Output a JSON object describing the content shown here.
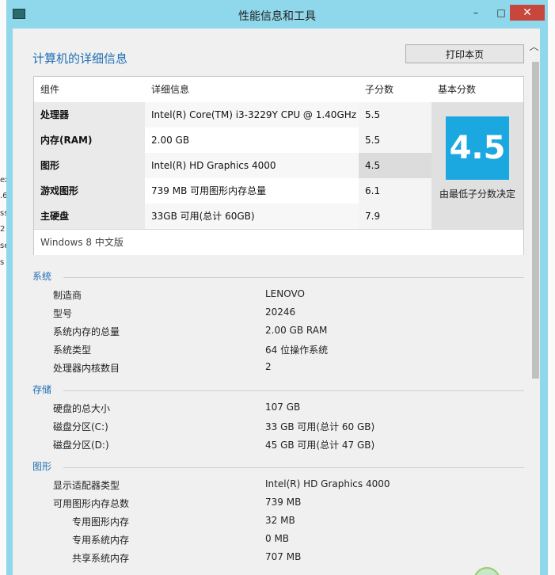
{
  "window": {
    "title": "性能信息和工具",
    "controls": {
      "minimize": "–",
      "maximize": "□",
      "close": "✕"
    }
  },
  "main": {
    "heading": "计算机的详细信息",
    "print_button": "打印本页",
    "score_table": {
      "headers": [
        "组件",
        "详细信息",
        "子分数",
        "基本分数"
      ],
      "rows": [
        {
          "component": "处理器",
          "detail": "Intel(R) Core(TM) i3-3229Y CPU @ 1.40GHz",
          "subscore": "5.5"
        },
        {
          "component": "内存(RAM)",
          "detail": "2.00 GB",
          "subscore": "5.5"
        },
        {
          "component": "图形",
          "detail": "Intel(R) HD Graphics 4000",
          "subscore": "4.5"
        },
        {
          "component": "游戏图形",
          "detail": "739 MB 可用图形内存总量",
          "subscore": "6.1"
        },
        {
          "component": "主硬盘",
          "detail": "33GB 可用(总计 60GB)",
          "subscore": "7.9"
        }
      ],
      "base_score": "4.5",
      "base_note": "由最低子分数决定",
      "os": "Windows 8 中文版"
    },
    "system": {
      "label": "系统",
      "items": [
        {
          "k": "制造商",
          "v": "LENOVO"
        },
        {
          "k": "型号",
          "v": "20246"
        },
        {
          "k": "系统内存的总量",
          "v": "2.00 GB RAM"
        },
        {
          "k": "系统类型",
          "v": "64 位操作系统"
        },
        {
          "k": "处理器内核数目",
          "v": "2"
        }
      ]
    },
    "storage": {
      "label": "存储",
      "items": [
        {
          "k": "硬盘的总大小",
          "v": "107 GB"
        },
        {
          "k": "磁盘分区(C:)",
          "v": "33 GB 可用(总计 60 GB)"
        },
        {
          "k": "磁盘分区(D:)",
          "v": "45 GB 可用(总计 47 GB)"
        }
      ]
    },
    "graphics": {
      "label": "图形",
      "items": [
        {
          "k": "显示适配器类型",
          "v": "Intel(R) HD Graphics 4000"
        },
        {
          "k": "可用图形内存总数",
          "v": "739 MB"
        },
        {
          "k": "专用图形内存",
          "v": "32 MB"
        },
        {
          "k": "专用系统内存",
          "v": "0 MB"
        },
        {
          "k": "共享系统内存",
          "v": "707 MB"
        }
      ]
    }
  },
  "background": {
    "left_fragments": [
      "ex",
      ".6",
      "ss",
      "2",
      "se",
      "s"
    ]
  }
}
